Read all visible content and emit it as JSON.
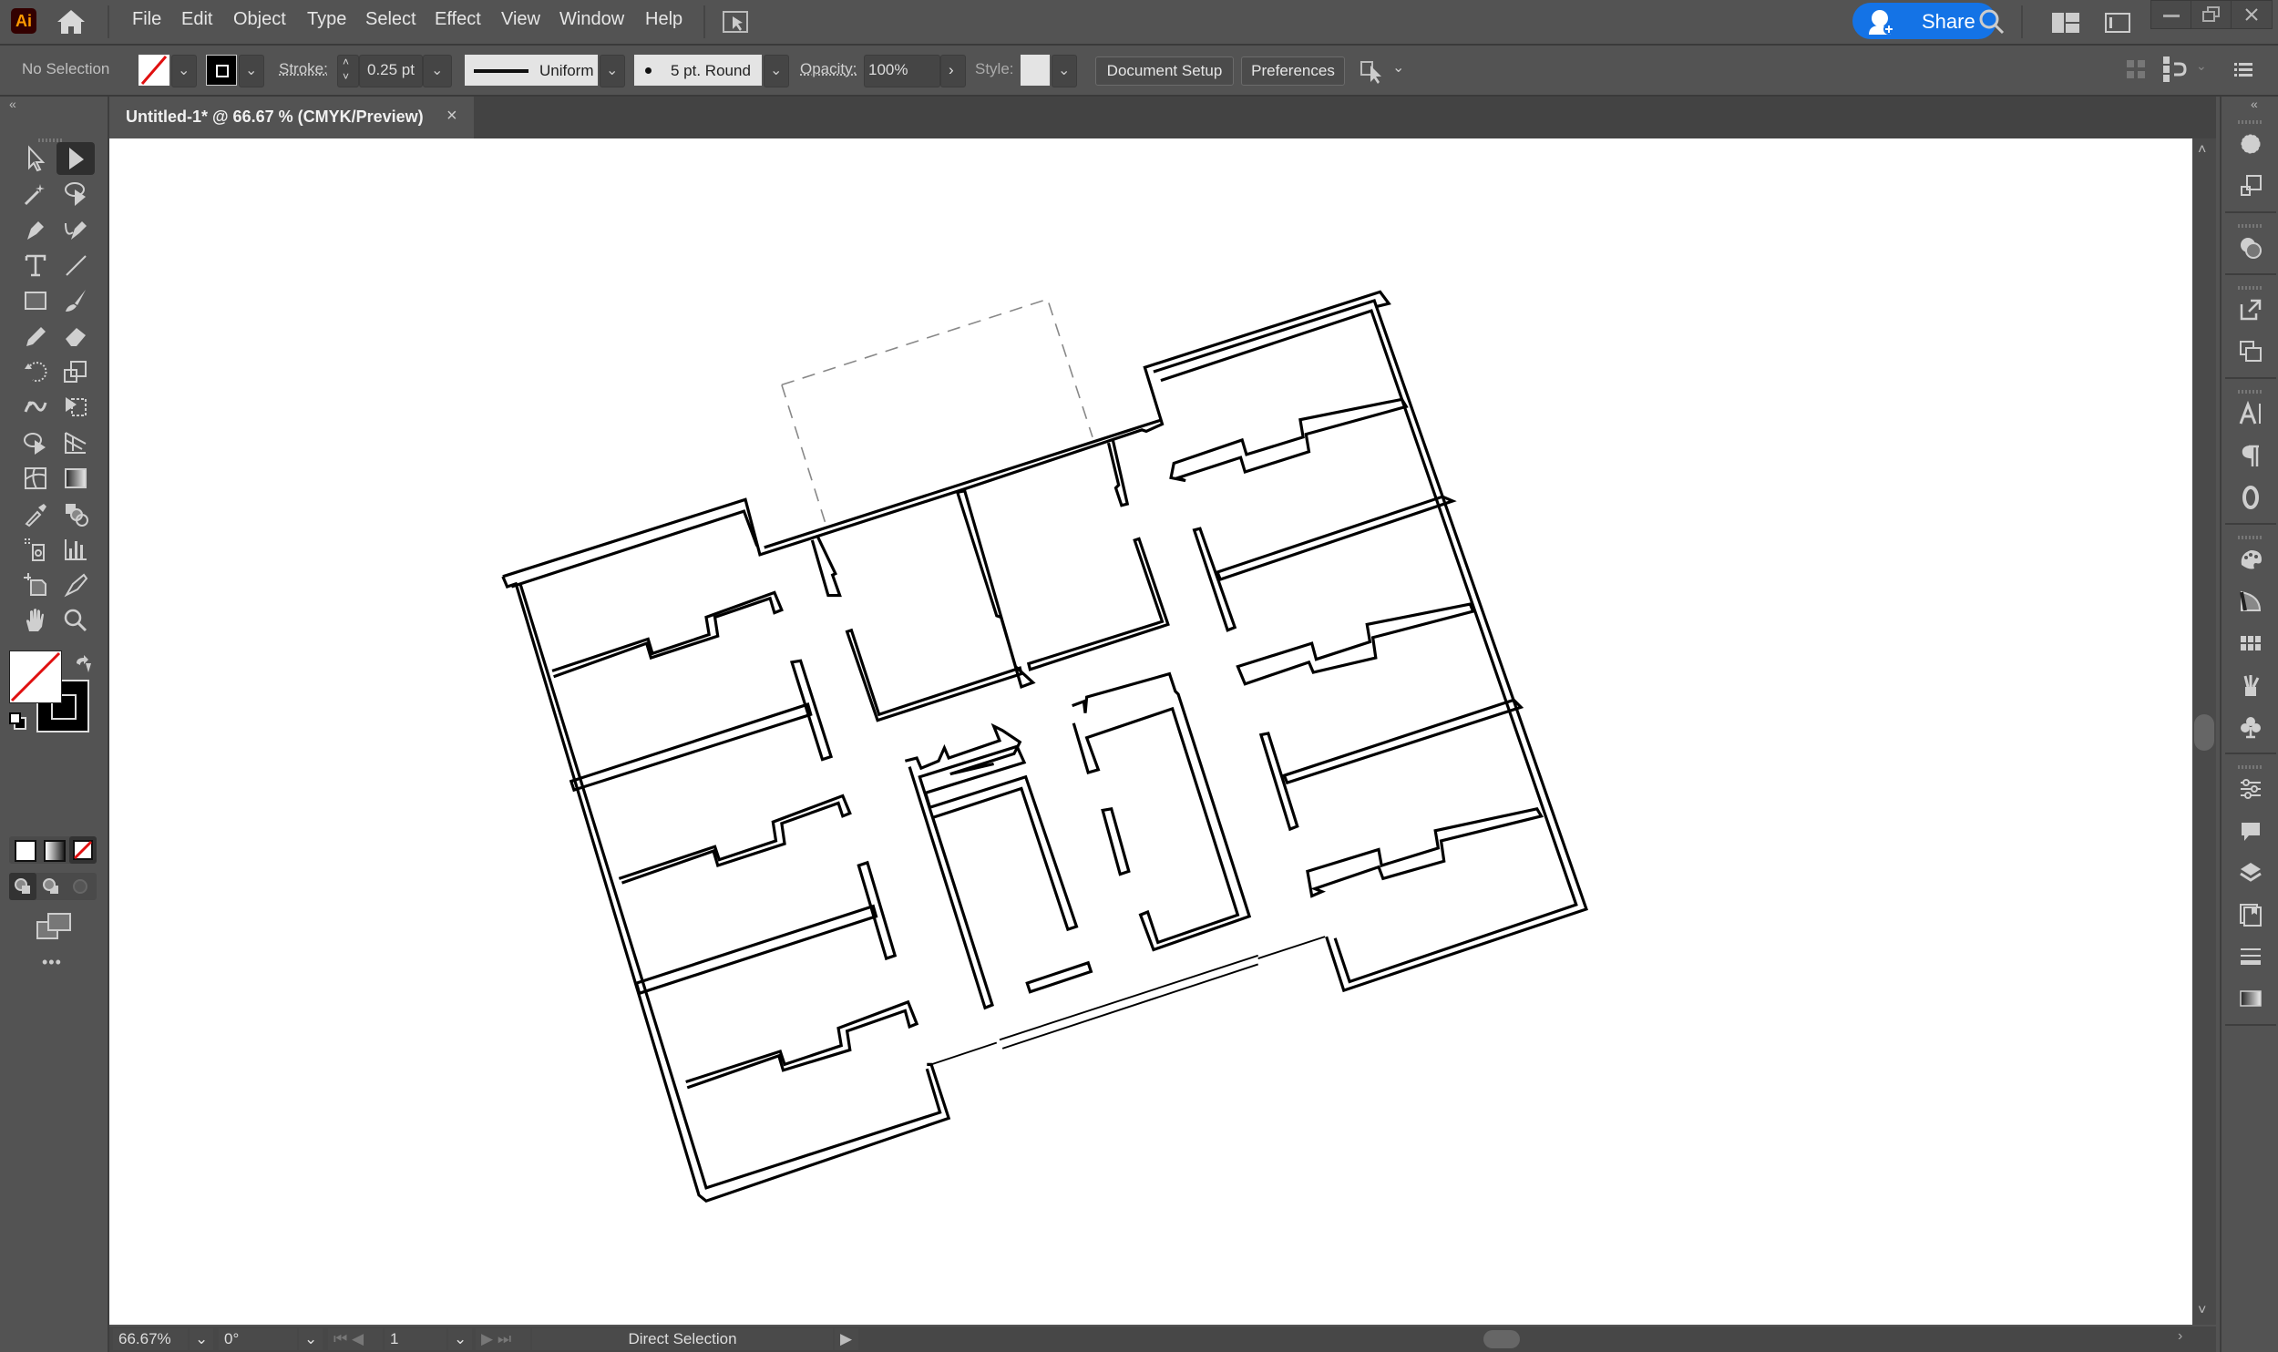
{
  "app": {
    "name": "Adobe Illustrator",
    "logo_text": "Ai"
  },
  "menu": {
    "items": [
      "File",
      "Edit",
      "Object",
      "Type",
      "Select",
      "Effect",
      "View",
      "Window",
      "Help"
    ],
    "share_label": "Share"
  },
  "control_bar": {
    "selection_status": "No Selection",
    "fill": "none",
    "stroke_label": "Stroke:",
    "stroke_weight": "0.25 pt",
    "stroke_profile": "Uniform",
    "brush": "5 pt. Round",
    "opacity_label": "Opacity:",
    "opacity_value": "100%",
    "style_label": "Style:",
    "document_setup_label": "Document Setup",
    "preferences_label": "Preferences"
  },
  "document": {
    "tab_title": "Untitled-1* @ 66.67 % (CMYK/Preview)",
    "close_glyph": "×"
  },
  "toolbar": {
    "tools": [
      "selection-tool",
      "direct-selection-tool",
      "magic-wand-tool",
      "lasso-tool",
      "pen-tool",
      "curvature-tool",
      "type-tool",
      "line-segment-tool",
      "rectangle-tool",
      "paintbrush-tool",
      "pencil-tool",
      "eraser-tool",
      "rotate-tool",
      "scale-tool",
      "puppet-warp-tool",
      "free-transform-tool",
      "shape-builder-tool",
      "perspective-grid-tool",
      "mesh-tool",
      "gradient-tool",
      "eyedropper-tool",
      "blend-tool",
      "symbol-sprayer-tool",
      "column-graph-tool",
      "artboard-tool",
      "slice-tool",
      "hand-tool",
      "zoom-tool"
    ],
    "active_tool": "direct-selection-tool",
    "more_glyph": "•••"
  },
  "colors": {
    "accent": "#1473e6",
    "none_swatch_slash": "#e01010",
    "stroke_swatch": "#000000",
    "canvas": "#ffffff",
    "ui_bg": "#535353"
  },
  "status_bar": {
    "zoom": "66.67%",
    "rotation": "0°",
    "artboard_number": "1",
    "current_tool": "Direct Selection"
  },
  "right_dock": {
    "groups": [
      [
        "appearance-icon",
        "transform-icon"
      ],
      [
        "pathfinder-icon"
      ],
      [
        "export-icon",
        "artboards-icon"
      ],
      [
        "character-icon",
        "paragraph-icon",
        "opentype-icon"
      ],
      [
        "color-icon",
        "color-guide-icon",
        "swatches-icon",
        "brushes-icon",
        "symbols-icon"
      ],
      [
        "properties-icon",
        "comments-icon",
        "layers-icon",
        "libraries-icon",
        "align-icon",
        "gradient-icon"
      ]
    ]
  },
  "artwork": {
    "description": "Rotated architectural floor plan",
    "stroke_color": "#000000",
    "dashed_outline_color": "#888888"
  }
}
